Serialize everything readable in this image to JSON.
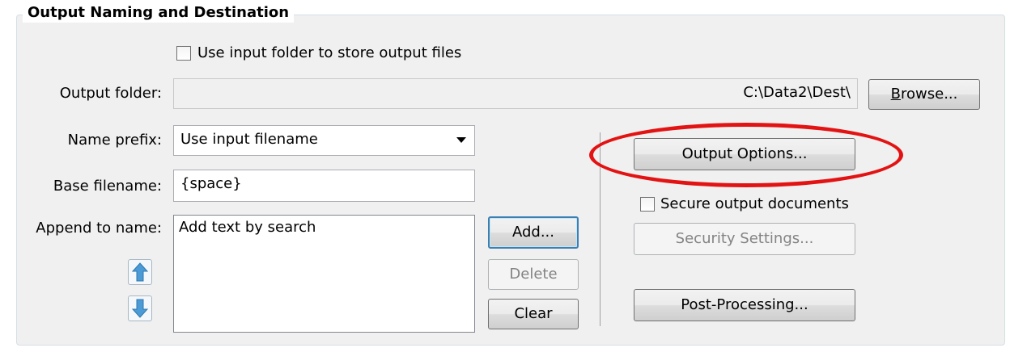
{
  "group": {
    "title": "Output Naming and Destination"
  },
  "use_input_folder": {
    "label": "Use input folder to store output files",
    "checked": false
  },
  "output_folder": {
    "label": "Output folder:",
    "value": "C:\\Data2\\Dest\\",
    "browse_label": "Browse...",
    "browse_accel": "B",
    "browse_rest": "rowse..."
  },
  "name_prefix": {
    "label": "Name prefix:",
    "value": "Use input filename"
  },
  "base_filename": {
    "label": "Base filename:",
    "value": "{space}"
  },
  "append": {
    "label": "Append to name:",
    "items": [
      "Add text by search"
    ],
    "add_label": "Add...",
    "delete_label": "Delete",
    "clear_label": "Clear"
  },
  "right_panel": {
    "output_options_label": "Output Options...",
    "secure_label": "Secure output documents",
    "secure_checked": false,
    "security_settings_label": "Security Settings...",
    "post_processing_label": "Post-Processing..."
  },
  "icons": {
    "move_up": "arrow-up-icon",
    "move_down": "arrow-down-icon",
    "dropdown": "chevron-down-icon"
  },
  "colors": {
    "highlight": "#e31313",
    "icon_blue": "#4a9bd6",
    "default_button_border": "#3c7fb1"
  }
}
